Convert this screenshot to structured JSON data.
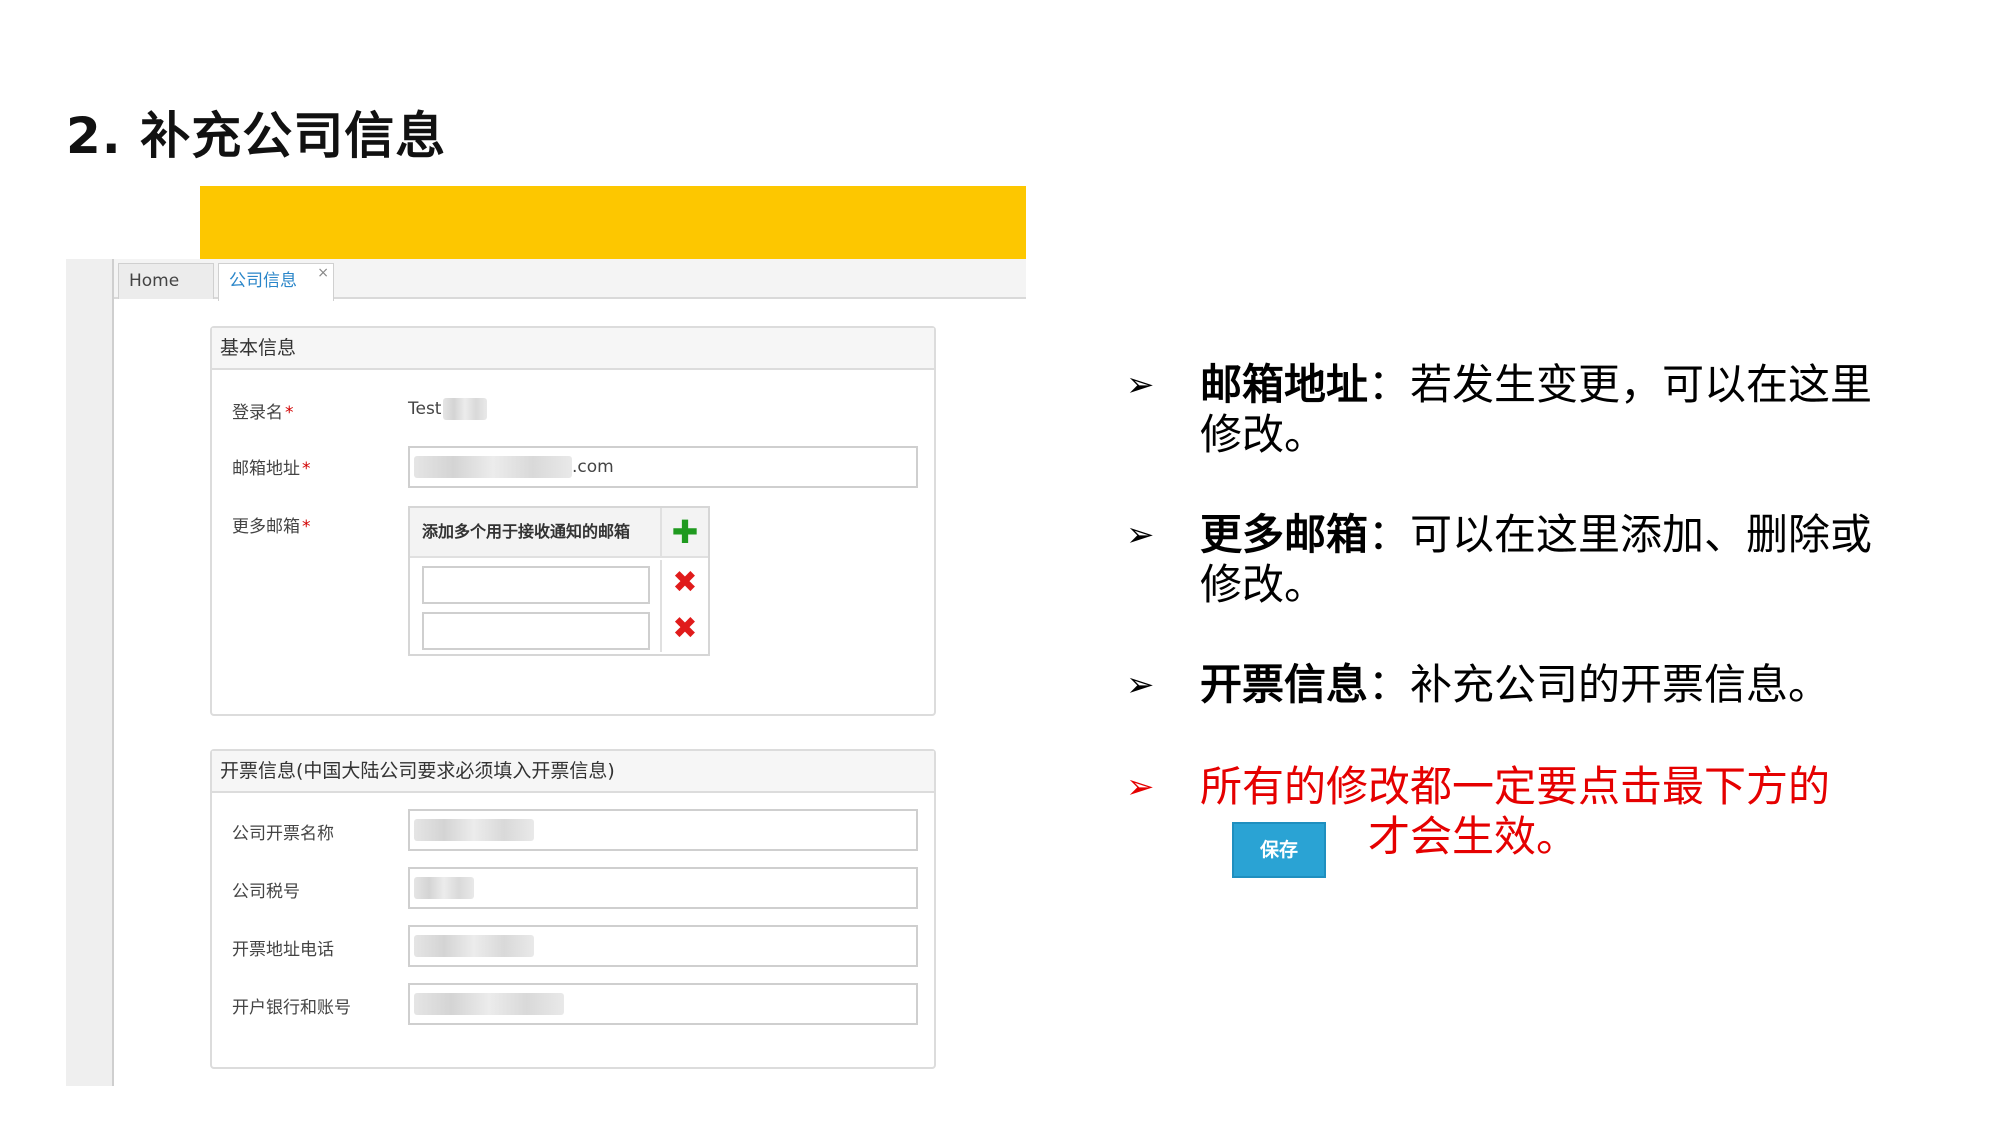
{
  "slide": {
    "title": "2. 补充公司信息"
  },
  "screenshot": {
    "tabs": {
      "home": "Home",
      "company": "公司信息",
      "close": "×"
    },
    "basic_panel": {
      "title": "基本信息",
      "login_label": "登录名",
      "login_value": "Test",
      "email_label": "邮箱地址",
      "email_value_suffix": ".com",
      "more_emails_label": "更多邮箱",
      "more_emails_header": "添加多个用于接收通知的邮箱",
      "add_icon": "✚",
      "delete_icon": "✖",
      "required_mark": "*"
    },
    "invoice_panel": {
      "title": "开票信息(中国大陆公司要求必须填入开票信息)",
      "fields": {
        "name_label": "公司开票名称",
        "tax_label": "公司税号",
        "address_label": "开票地址电话",
        "bank_label": "开户银行和账号"
      }
    }
  },
  "bullets": {
    "arrow": "➢",
    "b1_bold": "邮箱地址",
    "b1_text": "：若发生变更，可以在这里修改。",
    "b2_bold": "更多邮箱",
    "b2_text": "：可以在这里添加、删除或修改。",
    "b3_bold": "开票信息",
    "b3_text": "：补充公司的开票信息。",
    "b4_text": "所有的修改都一定要点击最下方的",
    "save_button": "保存",
    "b4_tail": "才会生效。"
  },
  "colors": {
    "banner": "#fdc700",
    "tab_active": "#2a86c9",
    "required": "#d10000",
    "add": "#1f9a1f",
    "delete": "#e01b1b",
    "emphasis": "#e50000",
    "save_button": "#2aa3d4"
  }
}
